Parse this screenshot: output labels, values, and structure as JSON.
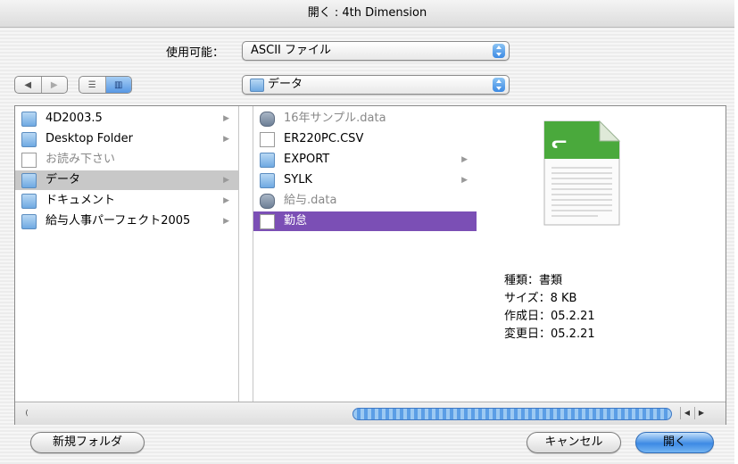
{
  "window": {
    "title": "開く : 4th Dimension"
  },
  "enable": {
    "label": "使用可能：",
    "value": "ASCII ファイル"
  },
  "nav": {
    "back_icon": "back-arrow-icon",
    "forward_icon": "forward-arrow-icon",
    "list_view_icon": "list-view-icon",
    "column_view_icon": "column-view-icon"
  },
  "location": {
    "value": "データ"
  },
  "columns": [
    {
      "items": [
        {
          "label": "4D2003.5",
          "icon": "folder",
          "arrow": true,
          "state": "normal"
        },
        {
          "label": "Desktop Folder",
          "icon": "folder",
          "arrow": true,
          "state": "normal"
        },
        {
          "label": "お読み下さい",
          "icon": "document",
          "arrow": false,
          "state": "disabled"
        },
        {
          "label": "データ",
          "icon": "folder",
          "arrow": true,
          "state": "selected"
        },
        {
          "label": "ドキュメント",
          "icon": "folder",
          "arrow": true,
          "state": "normal"
        },
        {
          "label": "給与人事パーフェクト2005",
          "icon": "folder",
          "arrow": true,
          "state": "normal"
        }
      ]
    },
    {
      "items": [
        {
          "label": "16年サンプル.data",
          "icon": "data-file",
          "arrow": false,
          "state": "disabled"
        },
        {
          "label": "ER220PC.CSV",
          "icon": "document",
          "arrow": false,
          "state": "normal"
        },
        {
          "label": "EXPORT",
          "icon": "folder",
          "arrow": true,
          "state": "normal"
        },
        {
          "label": "SYLK",
          "icon": "folder",
          "arrow": true,
          "state": "normal"
        },
        {
          "label": "給与.data",
          "icon": "data-file",
          "arrow": false,
          "state": "disabled"
        },
        {
          "label": "勤怠",
          "icon": "document",
          "arrow": false,
          "state": "highlighted"
        }
      ]
    }
  ],
  "preview": {
    "icon": "text-document-icon",
    "kind": "種類：書類",
    "size": "サイズ：8 KB",
    "created": "作成日：05.2.21",
    "modified": "変更日：05.2.21"
  },
  "buttons": {
    "new_folder": "新規フォルダ",
    "cancel": "キャンセル",
    "open": "開く"
  },
  "colors": {
    "selection": "#7b4fb5",
    "accent": "#3d8ae4",
    "folder": "#6fa9e2"
  }
}
